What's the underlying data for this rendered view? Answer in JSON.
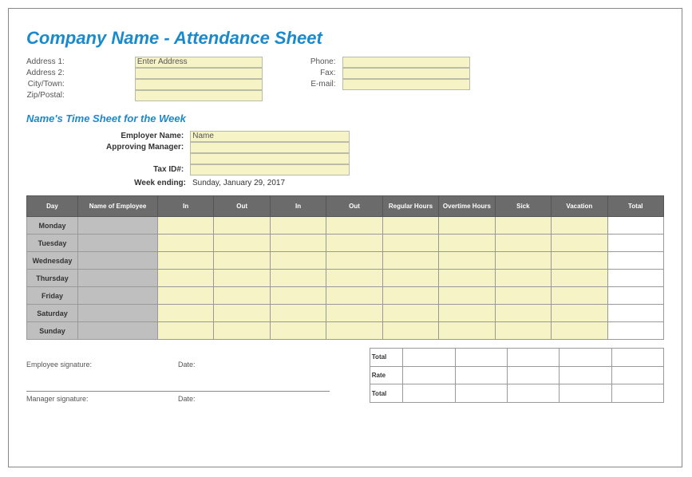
{
  "title": "Company Name - Attendance Sheet",
  "subtitle": "Name's Time Sheet for the Week",
  "addr_labels": {
    "a1": "Address 1:",
    "a2": "Address 2:",
    "city": "City/Town:",
    "zip": "Zip/Postal:"
  },
  "addr_vals": {
    "a1": "Enter Address",
    "a2": "",
    "city": "",
    "zip": ""
  },
  "contact_labels": {
    "phone": "Phone:",
    "fax": "Fax:",
    "email": "E-mail:"
  },
  "contact_vals": {
    "phone": "",
    "fax": "",
    "email": ""
  },
  "emp_labels": {
    "name": "Employer Name:",
    "mgr": "Approving Manager:",
    "blank": "",
    "tax": "Tax ID#:"
  },
  "emp_vals": {
    "name": "Name",
    "mgr": "",
    "blank": "",
    "tax": ""
  },
  "week_label": "Week ending:",
  "week_value": "Sunday, January 29, 2017",
  "headers": [
    "Day",
    "Name of Employee",
    "In",
    "Out",
    "In",
    "Out",
    "Regular Hours",
    "Overtime Hours",
    "Sick",
    "Vacation",
    "Total"
  ],
  "days": [
    "Monday",
    "Tuesday",
    "Wednesday",
    "Thursday",
    "Friday",
    "Saturday",
    "Sunday"
  ],
  "sig1": "Employee signature:",
  "sig2": "Manager signature:",
  "date": "Date:",
  "tot_rows": [
    "Total",
    "Rate",
    "Total"
  ]
}
